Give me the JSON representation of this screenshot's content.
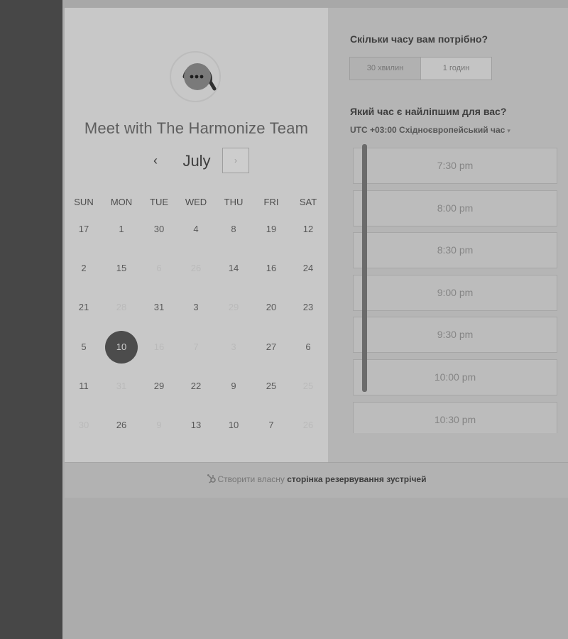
{
  "calendar": {
    "title": "Meet with The Harmonize Team",
    "month": "July",
    "prev_icon": "chevron-left-icon",
    "next_icon": "chevron-right-icon",
    "weekdays": [
      "SUN",
      "MON",
      "TUE",
      "WED",
      "THU",
      "FRI",
      "SAT"
    ],
    "weeks": [
      [
        {
          "d": "17",
          "m": false
        },
        {
          "d": "1",
          "m": false
        },
        {
          "d": "30",
          "m": false
        },
        {
          "d": "4",
          "m": false
        },
        {
          "d": "8",
          "m": false
        },
        {
          "d": "19",
          "m": false
        },
        {
          "d": "12",
          "m": false
        }
      ],
      [
        {
          "d": "2",
          "m": false
        },
        {
          "d": "15",
          "m": false
        },
        {
          "d": "6",
          "m": true
        },
        {
          "d": "26",
          "m": true
        },
        {
          "d": "14",
          "m": false
        },
        {
          "d": "16",
          "m": false
        },
        {
          "d": "24",
          "m": false
        }
      ],
      [
        {
          "d": "21",
          "m": false
        },
        {
          "d": "28",
          "m": true
        },
        {
          "d": "31",
          "m": false
        },
        {
          "d": "3",
          "m": false
        },
        {
          "d": "29",
          "m": true
        },
        {
          "d": "20",
          "m": false
        },
        {
          "d": "23",
          "m": false
        }
      ],
      [
        {
          "d": "5",
          "m": false
        },
        {
          "d": "10",
          "m": false,
          "selected": true
        },
        {
          "d": "16",
          "m": true
        },
        {
          "d": "7",
          "m": true
        },
        {
          "d": "3",
          "m": true
        },
        {
          "d": "27",
          "m": false
        },
        {
          "d": "6",
          "m": false
        }
      ],
      [
        {
          "d": "11",
          "m": false
        },
        {
          "d": "31",
          "m": true
        },
        {
          "d": "29",
          "m": false
        },
        {
          "d": "22",
          "m": false
        },
        {
          "d": "9",
          "m": false
        },
        {
          "d": "25",
          "m": false
        },
        {
          "d": "25",
          "m": true
        }
      ],
      [
        {
          "d": "30",
          "m": true
        },
        {
          "d": "26",
          "m": false
        },
        {
          "d": "9",
          "m": true
        },
        {
          "d": "13",
          "m": false
        },
        {
          "d": "10",
          "m": false
        },
        {
          "d": "7",
          "m": false
        },
        {
          "d": "26",
          "m": true
        }
      ]
    ]
  },
  "duration": {
    "question": "Скільки часу вам потрібно?",
    "options": [
      "30 хвилин",
      "1 годин"
    ],
    "selected": "30 хвилин"
  },
  "time": {
    "question": "Який час є найліпшим для вас?",
    "timezone": "UTC +03:00 Східноєвропейський час",
    "timezone_icon": "caret-down-icon",
    "slots": [
      "7:30 pm",
      "8:00 pm",
      "8:30 pm",
      "9:00 pm",
      "9:30 pm",
      "10:00 pm",
      "10:30 pm"
    ]
  },
  "footer": {
    "icon": "hubspot-sprocket-icon",
    "prefix": "Створити власну",
    "link": "сторінка резервування зустрічей"
  },
  "colors": {
    "selected_day": "#4c4c4c",
    "page_background": "#acacac",
    "left_strip": "#474747"
  }
}
